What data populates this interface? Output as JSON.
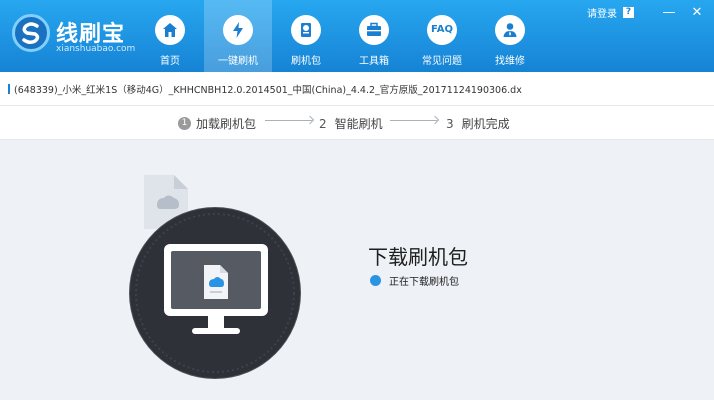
{
  "app": {
    "name": "线刷宝",
    "domain": "xianshuabao.com"
  },
  "nav": [
    {
      "label": "首页",
      "icon": "home-icon",
      "active": false
    },
    {
      "label": "一键刷机",
      "icon": "flash-icon",
      "active": true
    },
    {
      "label": "刷机包",
      "icon": "package-icon",
      "active": false
    },
    {
      "label": "工具箱",
      "icon": "toolbox-icon",
      "active": false
    },
    {
      "label": "常见问题",
      "icon": "faq-icon",
      "text": "FAQ",
      "active": false
    },
    {
      "label": "找维修",
      "icon": "repair-person-icon",
      "active": false
    }
  ],
  "topright": {
    "login": "请登录",
    "help": "?",
    "minimize": "—",
    "close": "✕"
  },
  "file": {
    "name": "(648339)_小米_红米1S（移动4G）_KHHCNBH12.0.2014501_中国(China)_4.4.2_官方原版_20171124190306.dx"
  },
  "steps": [
    {
      "num": "1",
      "label": "加载刷机包",
      "current": true
    },
    {
      "num": "2",
      "label": "智能刷机",
      "current": false
    },
    {
      "num": "3",
      "label": "刷机完成",
      "current": false
    }
  ],
  "main": {
    "title": "下载刷机包",
    "status": "正在下载刷机包"
  },
  "colors": {
    "header": "#1e95e4",
    "accent": "#2b93e4",
    "illustration_dark": "#2e3238"
  }
}
